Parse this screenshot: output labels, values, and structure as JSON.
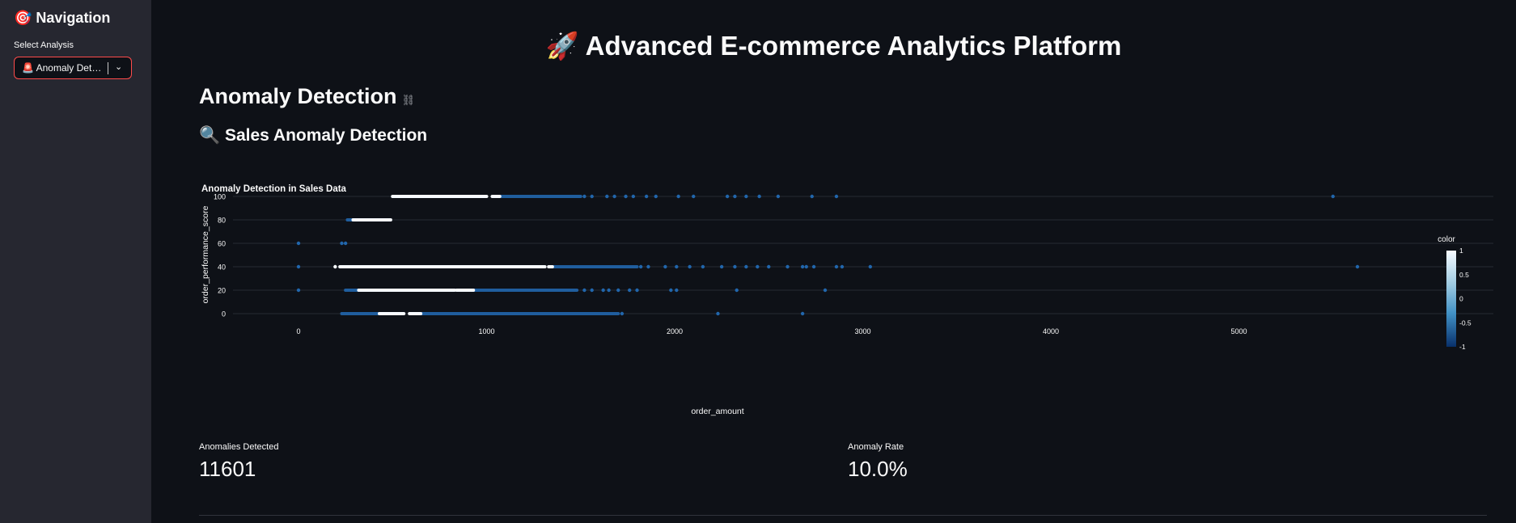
{
  "sidebar": {
    "title": "🎯 Navigation",
    "select_label": "Select Analysis",
    "select_value": "🚨 Anomaly Detection",
    "chevron": "⌄"
  },
  "main": {
    "app_title": "🚀 Advanced E-commerce Analytics Platform",
    "section_title": "Anomaly Detection",
    "link_icon": "⛓",
    "subsection_title": "🔍 Sales Anomaly Detection"
  },
  "metrics": [
    {
      "label": "Anomalies Detected",
      "value": "11601"
    },
    {
      "label": "Anomaly Rate",
      "value": "10.0%"
    }
  ],
  "colors": {
    "accent": "#ff4b4b",
    "normal_point": "#f7fbff",
    "anomaly_point": "#2166ac"
  },
  "chart_data": {
    "type": "scatter",
    "title": "Anomaly Detection in Sales Data",
    "xlabel": "order_amount",
    "ylabel": "order_performance_score",
    "xlim": [
      -270,
      5720
    ],
    "ylim": [
      -8,
      108
    ],
    "x_ticks": [
      0,
      1000,
      2000,
      3000,
      4000,
      5000
    ],
    "y_ticks": [
      0,
      20,
      40,
      60,
      80,
      100
    ],
    "grid": "horizontal",
    "colorbar": {
      "title": "color",
      "min": -1,
      "max": 1,
      "ticks": [
        1,
        0.5,
        0,
        -0.5,
        -1
      ]
    },
    "normal_segments": [
      {
        "y": 100,
        "x_start": 500,
        "x_end": 1000
      },
      {
        "y": 100,
        "x_start": 1030,
        "x_end": 1070
      },
      {
        "y": 80,
        "x_start": 290,
        "x_end": 490
      },
      {
        "y": 40,
        "x_start": 220,
        "x_end": 1310
      },
      {
        "y": 40,
        "x_start": 1330,
        "x_end": 1350
      },
      {
        "y": 20,
        "x_start": 320,
        "x_end": 830
      },
      {
        "y": 20,
        "x_start": 840,
        "x_end": 930
      },
      {
        "y": 0,
        "x_start": 430,
        "x_end": 560
      },
      {
        "y": 0,
        "x_start": 590,
        "x_end": 650
      }
    ],
    "normal_points": [
      {
        "x": 195,
        "y": 40
      }
    ],
    "anomaly_segments": [
      {
        "y": 100,
        "x_start": 1070,
        "x_end": 1500
      },
      {
        "y": 80,
        "x_start": 260,
        "x_end": 290
      },
      {
        "y": 40,
        "x_start": 1350,
        "x_end": 1800
      },
      {
        "y": 20,
        "x_start": 250,
        "x_end": 320
      },
      {
        "y": 20,
        "x_start": 930,
        "x_end": 1480
      },
      {
        "y": 0,
        "x_start": 230,
        "x_end": 430
      },
      {
        "y": 0,
        "x_start": 650,
        "x_end": 1700
      }
    ],
    "anomaly_points": [
      {
        "x": 1520,
        "y": 100
      },
      {
        "x": 1560,
        "y": 100
      },
      {
        "x": 1640,
        "y": 100
      },
      {
        "x": 1680,
        "y": 100
      },
      {
        "x": 1740,
        "y": 100
      },
      {
        "x": 1780,
        "y": 100
      },
      {
        "x": 1850,
        "y": 100
      },
      {
        "x": 1900,
        "y": 100
      },
      {
        "x": 2020,
        "y": 100
      },
      {
        "x": 2100,
        "y": 100
      },
      {
        "x": 2280,
        "y": 100
      },
      {
        "x": 2320,
        "y": 100
      },
      {
        "x": 2380,
        "y": 100
      },
      {
        "x": 2450,
        "y": 100
      },
      {
        "x": 2550,
        "y": 100
      },
      {
        "x": 2730,
        "y": 100
      },
      {
        "x": 2860,
        "y": 100
      },
      {
        "x": 5500,
        "y": 100
      },
      {
        "x": 0,
        "y": 60
      },
      {
        "x": 230,
        "y": 60
      },
      {
        "x": 250,
        "y": 60
      },
      {
        "x": 0,
        "y": 40
      },
      {
        "x": 1820,
        "y": 40
      },
      {
        "x": 1860,
        "y": 40
      },
      {
        "x": 1950,
        "y": 40
      },
      {
        "x": 2010,
        "y": 40
      },
      {
        "x": 2080,
        "y": 40
      },
      {
        "x": 2150,
        "y": 40
      },
      {
        "x": 2250,
        "y": 40
      },
      {
        "x": 2320,
        "y": 40
      },
      {
        "x": 2380,
        "y": 40
      },
      {
        "x": 2440,
        "y": 40
      },
      {
        "x": 2500,
        "y": 40
      },
      {
        "x": 2600,
        "y": 40
      },
      {
        "x": 2680,
        "y": 40
      },
      {
        "x": 2700,
        "y": 40
      },
      {
        "x": 2740,
        "y": 40
      },
      {
        "x": 2860,
        "y": 40
      },
      {
        "x": 2890,
        "y": 40
      },
      {
        "x": 3040,
        "y": 40
      },
      {
        "x": 5630,
        "y": 40
      },
      {
        "x": 0,
        "y": 20
      },
      {
        "x": 1520,
        "y": 20
      },
      {
        "x": 1560,
        "y": 20
      },
      {
        "x": 1620,
        "y": 20
      },
      {
        "x": 1650,
        "y": 20
      },
      {
        "x": 1700,
        "y": 20
      },
      {
        "x": 1760,
        "y": 20
      },
      {
        "x": 1800,
        "y": 20
      },
      {
        "x": 1980,
        "y": 20
      },
      {
        "x": 2010,
        "y": 20
      },
      {
        "x": 2330,
        "y": 20
      },
      {
        "x": 2800,
        "y": 20
      },
      {
        "x": 1720,
        "y": 0
      },
      {
        "x": 2230,
        "y": 0
      },
      {
        "x": 2680,
        "y": 0
      }
    ]
  }
}
